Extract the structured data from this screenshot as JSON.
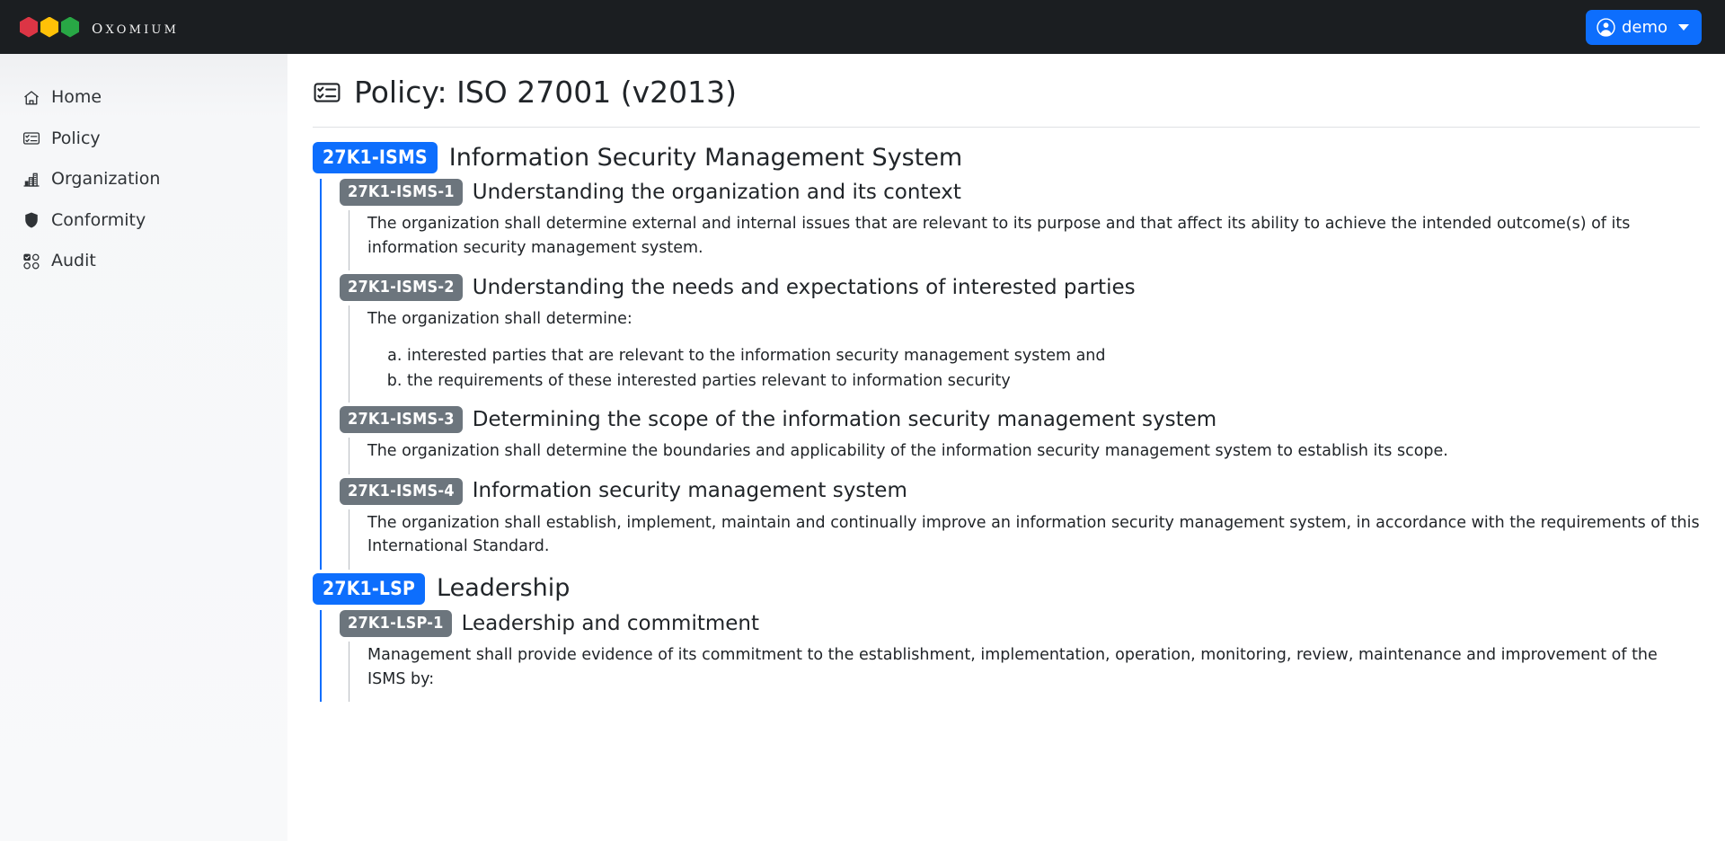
{
  "brand": {
    "name": "Oxomium",
    "hex_colors": [
      "#dc3545",
      "#ffc107",
      "#28a745"
    ]
  },
  "theme": {
    "topbar_bg": "#1b1e21",
    "primary": "#0d6efd",
    "secondary": "#6c757d"
  },
  "sidebar": {
    "items": [
      {
        "label": "Home",
        "icon": "home-icon"
      },
      {
        "label": "Policy",
        "icon": "policy-icon"
      },
      {
        "label": "Organization",
        "icon": "organization-icon"
      },
      {
        "label": "Conformity",
        "icon": "shield-icon"
      },
      {
        "label": "Audit",
        "icon": "audit-grid-icon"
      }
    ]
  },
  "topbar": {
    "user_label": "demo",
    "user_icon": "person-circle-icon",
    "caret_icon": "chevron-down-icon"
  },
  "page": {
    "title": "Policy: ISO 27001 (v2013)",
    "title_icon": "policy-icon"
  },
  "policy": {
    "domains": [
      {
        "code": "27K1-ISMS",
        "title": "Information Security Management System",
        "measures": [
          {
            "code": "27K1-ISMS-1",
            "title": "Understanding the organization and its context",
            "paragraphs": [
              "The organization shall determine external and internal issues that are relevant to its purpose and that affect its ability to achieve the intended outcome(s) of its information security management system."
            ],
            "list": []
          },
          {
            "code": "27K1-ISMS-2",
            "title": "Understanding the needs and expectations of interested parties",
            "paragraphs": [
              "The organization shall determine:"
            ],
            "list": [
              "interested parties that are relevant to the information security management system and",
              "the requirements of these interested parties relevant to information security"
            ]
          },
          {
            "code": "27K1-ISMS-3",
            "title": "Determining the scope of the information security management system",
            "paragraphs": [
              "The organization shall determine the boundaries and applicability of the information security management system to establish its scope."
            ],
            "list": []
          },
          {
            "code": "27K1-ISMS-4",
            "title": "Information security management system",
            "paragraphs": [
              "The organization shall establish, implement, maintain and continually improve an information security management system, in accordance with the requirements of this International Standard."
            ],
            "list": []
          }
        ]
      },
      {
        "code": "27K1-LSP",
        "title": "Leadership",
        "measures": [
          {
            "code": "27K1-LSP-1",
            "title": "Leadership and commitment",
            "paragraphs": [
              "Management shall provide evidence of its commitment to the establishment, implementation, operation, monitoring, review, maintenance and improvement of the ISMS by:"
            ],
            "list": []
          }
        ]
      }
    ]
  }
}
